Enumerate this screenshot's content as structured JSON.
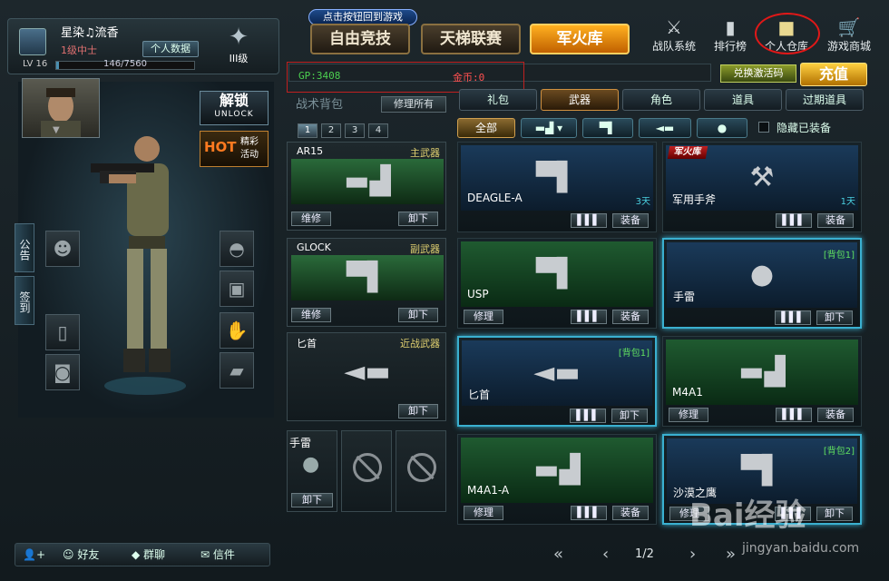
{
  "hint": "点击按钮回到游戏",
  "profile": {
    "name": "星染♫流香",
    "rank": "1级中士",
    "data_button": "个人数据",
    "level": "LV 16",
    "xp": "146/7560",
    "xp_fraction": 0.019,
    "emblem_rank": "III级"
  },
  "nav": {
    "tabs": [
      "自由竞技",
      "天梯联赛",
      "军火库"
    ],
    "active": 2,
    "icons": [
      {
        "label": "战队系统",
        "icon": "team-icon"
      },
      {
        "label": "排行榜",
        "icon": "ranking-icon"
      },
      {
        "label": "个人仓库",
        "icon": "warehouse-box-icon"
      },
      {
        "label": "游戏商城",
        "icon": "cart-icon"
      }
    ]
  },
  "currency": {
    "gp": "GP:3408",
    "gold": "金币:0",
    "redeem": "兑换激活码",
    "recharge": "充值"
  },
  "left": {
    "unlock_cn": "解锁",
    "unlock_en": "UNLOCK",
    "hot": "HOT",
    "hot_text": "精彩\n活动",
    "side_tabs": [
      "公告",
      "签到"
    ]
  },
  "bottom": {
    "friends": "好友",
    "group_chat": "群聊",
    "mail": "信件"
  },
  "backpack": {
    "title": "战术背包",
    "repair_all": "修理所有",
    "numbers": [
      "1",
      "2",
      "3",
      "4"
    ],
    "slots": [
      {
        "name": "AR15",
        "type": "主武器",
        "btn1": "维修",
        "btn2": "卸下"
      },
      {
        "name": "GLOCK",
        "type": "副武器",
        "btn1": "维修",
        "btn2": "卸下"
      },
      {
        "name": "匕首",
        "type": "近战武器",
        "btn2": "卸下"
      }
    ],
    "grenade": {
      "name": "手雷",
      "btn": "卸下"
    }
  },
  "categories": [
    "礼包",
    "武器",
    "角色",
    "道具",
    "过期道具"
  ],
  "active_category": 1,
  "filters": {
    "all": "全部",
    "hide_equipped": "隐藏已装备"
  },
  "items": [
    {
      "name": "DEAGLE-A",
      "days": "3天",
      "btn": "装备"
    },
    {
      "name": "军用手斧",
      "days": "1天",
      "badge": "军火库",
      "btn": "装备"
    },
    {
      "name": "USP",
      "repair": "修理",
      "btn": "装备"
    },
    {
      "name": "手雷",
      "tag": "[背包1]",
      "btn": "卸下"
    },
    {
      "name": "匕首",
      "tag": "[背包1]",
      "btn": "卸下"
    },
    {
      "name": "M4A1",
      "repair": "修理",
      "btn": "装备"
    },
    {
      "name": "M4A1-A",
      "repair": "修理",
      "btn": "装备"
    },
    {
      "name": "沙漠之鹰",
      "tag": "[背包2]",
      "repair": "修理",
      "btn": "卸下"
    }
  ],
  "pagination": {
    "text": "1/2"
  },
  "watermark": {
    "logo": "Bai经验",
    "url": "jingyan.baidu.com"
  }
}
